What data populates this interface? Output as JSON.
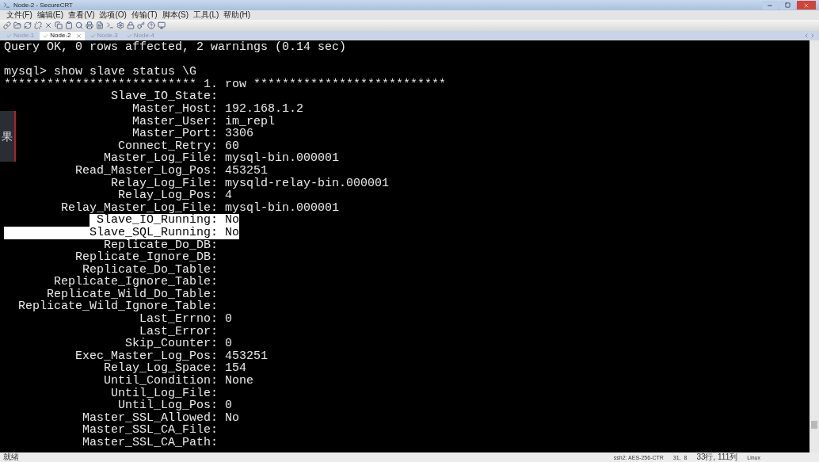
{
  "window": {
    "title": "Node-2 - SecureCRT"
  },
  "menu": [
    "文件(F)",
    "编辑(E)",
    "查看(V)",
    "选项(O)",
    "传输(T)",
    "脚本(S)",
    "工具(L)",
    "帮助(H)"
  ],
  "tabs": [
    {
      "label": "Node-1",
      "selected": false,
      "closable": false
    },
    {
      "label": "Node-2",
      "selected": true,
      "closable": true
    },
    {
      "label": "Node-3",
      "selected": false,
      "closable": false
    },
    {
      "label": "Node-4",
      "selected": false,
      "closable": false
    }
  ],
  "side_tab": {
    "label": "果"
  },
  "terminal": {
    "lines": [
      {
        "kind": "text",
        "text": "Query OK, 0 rows affected, 2 warnings (0.14 sec)"
      },
      {
        "kind": "blank"
      },
      {
        "kind": "text",
        "text": "mysql> show slave status \\G"
      },
      {
        "kind": "text",
        "text": "*************************** 1. row ***************************"
      },
      {
        "kind": "field",
        "label": "Slave_IO_State:",
        "selected": false
      },
      {
        "kind": "field",
        "label": "Master_Host:",
        "value": "192.168.1.2",
        "selected": false
      },
      {
        "kind": "field",
        "label": "Master_User:",
        "value": "im_repl",
        "selected": false
      },
      {
        "kind": "field",
        "label": "Master_Port:",
        "value": "3306",
        "selected": false
      },
      {
        "kind": "field",
        "label": "Connect_Retry:",
        "value": "60",
        "selected": false
      },
      {
        "kind": "field",
        "label": "Master_Log_File:",
        "value": "mysql-bin.000001",
        "selected": false
      },
      {
        "kind": "field",
        "label": "Read_Master_Log_Pos:",
        "value": "453251",
        "selected": false
      },
      {
        "kind": "field",
        "label": "Relay_Log_File:",
        "value": "mysqld-relay-bin.000001",
        "selected": false
      },
      {
        "kind": "field",
        "label": "Relay_Log_Pos:",
        "value": "4",
        "selected": false
      },
      {
        "kind": "field",
        "label": "Relay_Master_Log_File:",
        "value": "mysql-bin.000001",
        "selected": false
      },
      {
        "kind": "field",
        "label": "Slave_IO_Running:",
        "value": "No",
        "selected": true
      },
      {
        "kind": "field",
        "label": "Slave_SQL_Running:",
        "value": "No",
        "selected": true
      },
      {
        "kind": "field",
        "label": "Replicate_Do_DB:",
        "selected": false
      },
      {
        "kind": "field",
        "label": "Replicate_Ignore_DB:",
        "selected": false
      },
      {
        "kind": "field",
        "label": "Replicate_Do_Table:",
        "selected": false
      },
      {
        "kind": "field",
        "label": "Replicate_Ignore_Table:",
        "selected": false
      },
      {
        "kind": "field",
        "label": "Replicate_Wild_Do_Table:",
        "selected": false
      },
      {
        "kind": "field",
        "label": "Replicate_Wild_Ignore_Table:",
        "selected": false
      },
      {
        "kind": "field",
        "label": "Last_Errno:",
        "value": "0",
        "selected": false
      },
      {
        "kind": "field",
        "label": "Last_Error:",
        "selected": false
      },
      {
        "kind": "field",
        "label": "Skip_Counter:",
        "value": "0",
        "selected": false
      },
      {
        "kind": "field",
        "label": "Exec_Master_Log_Pos:",
        "value": "453251",
        "selected": false
      },
      {
        "kind": "field",
        "label": "Relay_Log_Space:",
        "value": "154",
        "selected": false
      },
      {
        "kind": "field",
        "label": "Until_Condition:",
        "value": "None",
        "selected": false
      },
      {
        "kind": "field",
        "label": "Until_Log_File:",
        "selected": false
      },
      {
        "kind": "field",
        "label": "Until_Log_Pos:",
        "value": "0",
        "selected": false
      },
      {
        "kind": "field",
        "label": "Master_SSL_Allowed:",
        "value": "No",
        "selected": false
      },
      {
        "kind": "field",
        "label": "Master_SSL_CA_File:",
        "selected": false
      },
      {
        "kind": "field",
        "label": "Master_SSL_CA_Path:",
        "selected": false
      }
    ]
  },
  "status_bar": {
    "status": "就绪",
    "cipher": "ssh2: AES-256-CTR",
    "cursor": "31,  8",
    "size": "33行, 111列",
    "os": "Linux"
  }
}
